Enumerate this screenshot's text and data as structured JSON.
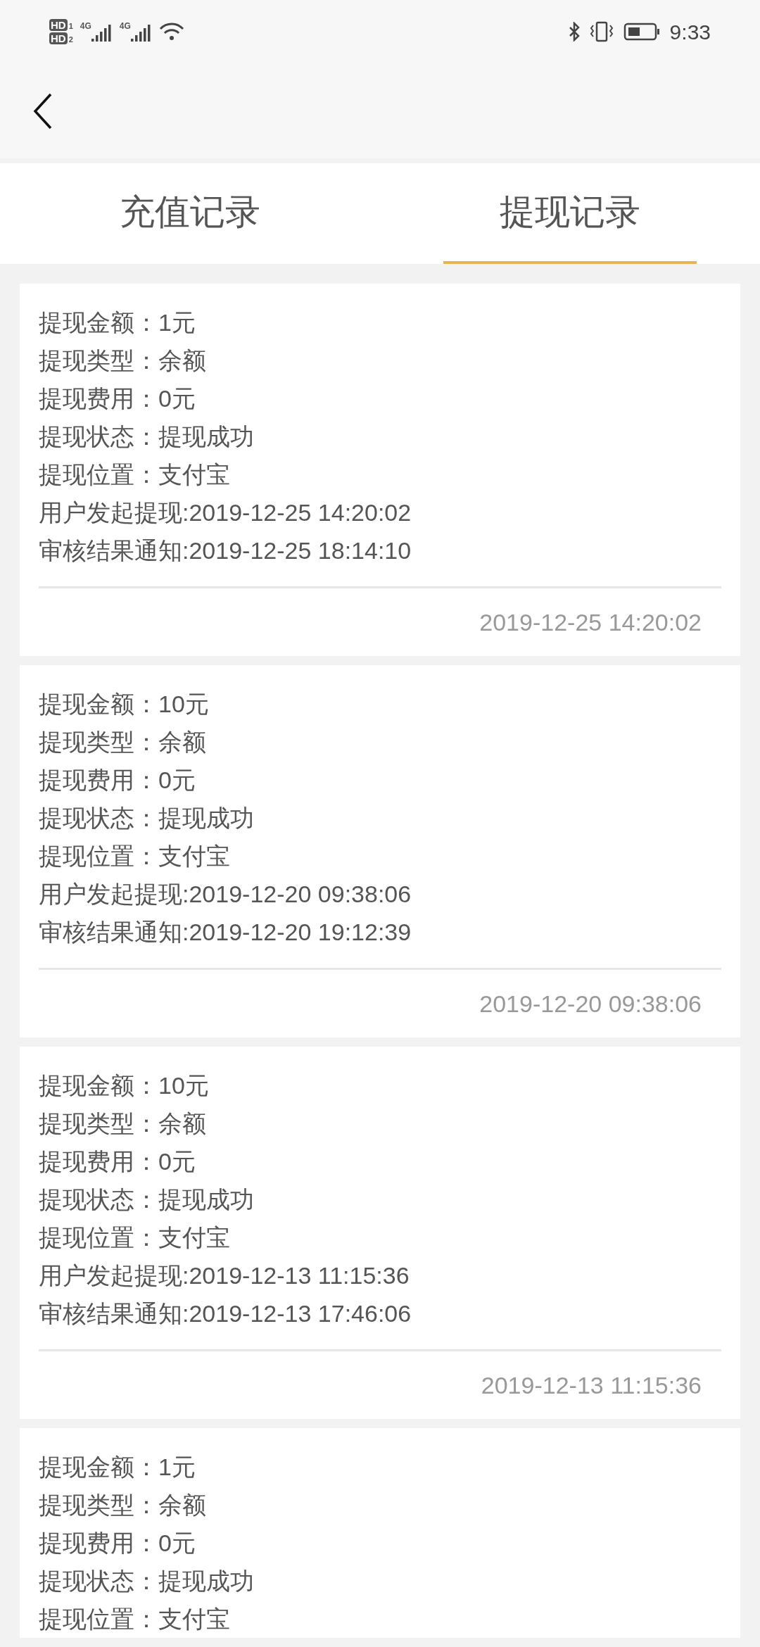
{
  "status_bar": {
    "sims": [
      {
        "hd": "HD",
        "slot": "1",
        "network": "4G"
      },
      {
        "hd": "HD",
        "slot": "2",
        "network": "4G"
      }
    ],
    "time": "9:33"
  },
  "tabs": [
    {
      "label": "充值记录",
      "selected": false
    },
    {
      "label": "提现记录",
      "selected": true
    }
  ],
  "records": [
    {
      "lines": [
        "提现金额：1元",
        "提现类型：余额",
        "提现费用：0元",
        "提现状态：提现成功",
        "提现位置：支付宝",
        "用户发起提现:2019-12-25 14:20:02",
        "审核结果通知:2019-12-25 18:14:10"
      ],
      "time": "2019-12-25 14:20:02"
    },
    {
      "lines": [
        "提现金额：10元",
        "提现类型：余额",
        "提现费用：0元",
        "提现状态：提现成功",
        "提现位置：支付宝",
        "用户发起提现:2019-12-20 09:38:06",
        "审核结果通知:2019-12-20 19:12:39"
      ],
      "time": "2019-12-20 09:38:06"
    },
    {
      "lines": [
        "提现金额：10元",
        "提现类型：余额",
        "提现费用：0元",
        "提现状态：提现成功",
        "提现位置：支付宝",
        "用户发起提现:2019-12-13 11:15:36",
        "审核结果通知:2019-12-13 17:46:06"
      ],
      "time": "2019-12-13 11:15:36"
    },
    {
      "lines": [
        "提现金额：1元",
        "提现类型：余额",
        "提现费用：0元",
        "提现状态：提现成功",
        "提现位置：支付宝"
      ]
    }
  ]
}
